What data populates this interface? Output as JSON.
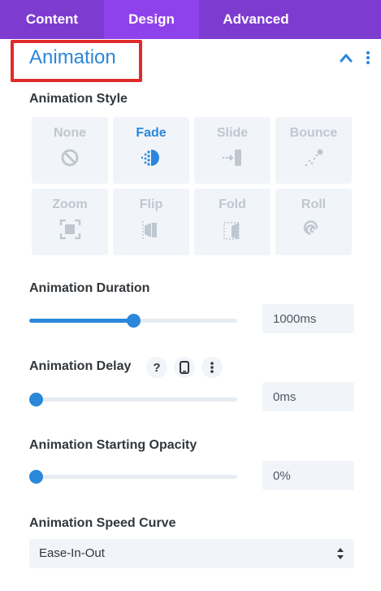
{
  "tabs": [
    {
      "label": "Content"
    },
    {
      "label": "Design"
    },
    {
      "label": "Advanced"
    }
  ],
  "active_tab": "Design",
  "section": {
    "title": "Animation"
  },
  "animation_style": {
    "label": "Animation Style",
    "selected": "Fade",
    "options": [
      {
        "label": "None",
        "icon": "none-icon"
      },
      {
        "label": "Fade",
        "icon": "fade-icon"
      },
      {
        "label": "Slide",
        "icon": "slide-icon"
      },
      {
        "label": "Bounce",
        "icon": "bounce-icon"
      },
      {
        "label": "Zoom",
        "icon": "zoom-icon"
      },
      {
        "label": "Flip",
        "icon": "flip-icon"
      },
      {
        "label": "Fold",
        "icon": "fold-icon"
      },
      {
        "label": "Roll",
        "icon": "roll-icon"
      }
    ]
  },
  "duration": {
    "label": "Animation Duration",
    "value": "1000ms",
    "slider_fraction": 0.5
  },
  "delay": {
    "label": "Animation Delay",
    "value": "0ms",
    "slider_fraction": 0.0,
    "help_glyph": "?"
  },
  "opacity": {
    "label": "Animation Starting Opacity",
    "value": "0%",
    "slider_fraction": 0.0
  },
  "speed_curve": {
    "label": "Animation Speed Curve",
    "value": "Ease-In-Out"
  },
  "colors": {
    "tab_bar": "#7e3bd0",
    "active_tab": "#8f42ec",
    "accent": "#2b87da",
    "highlight": "#e02b2b",
    "field_bg": "#f1f5f9"
  }
}
